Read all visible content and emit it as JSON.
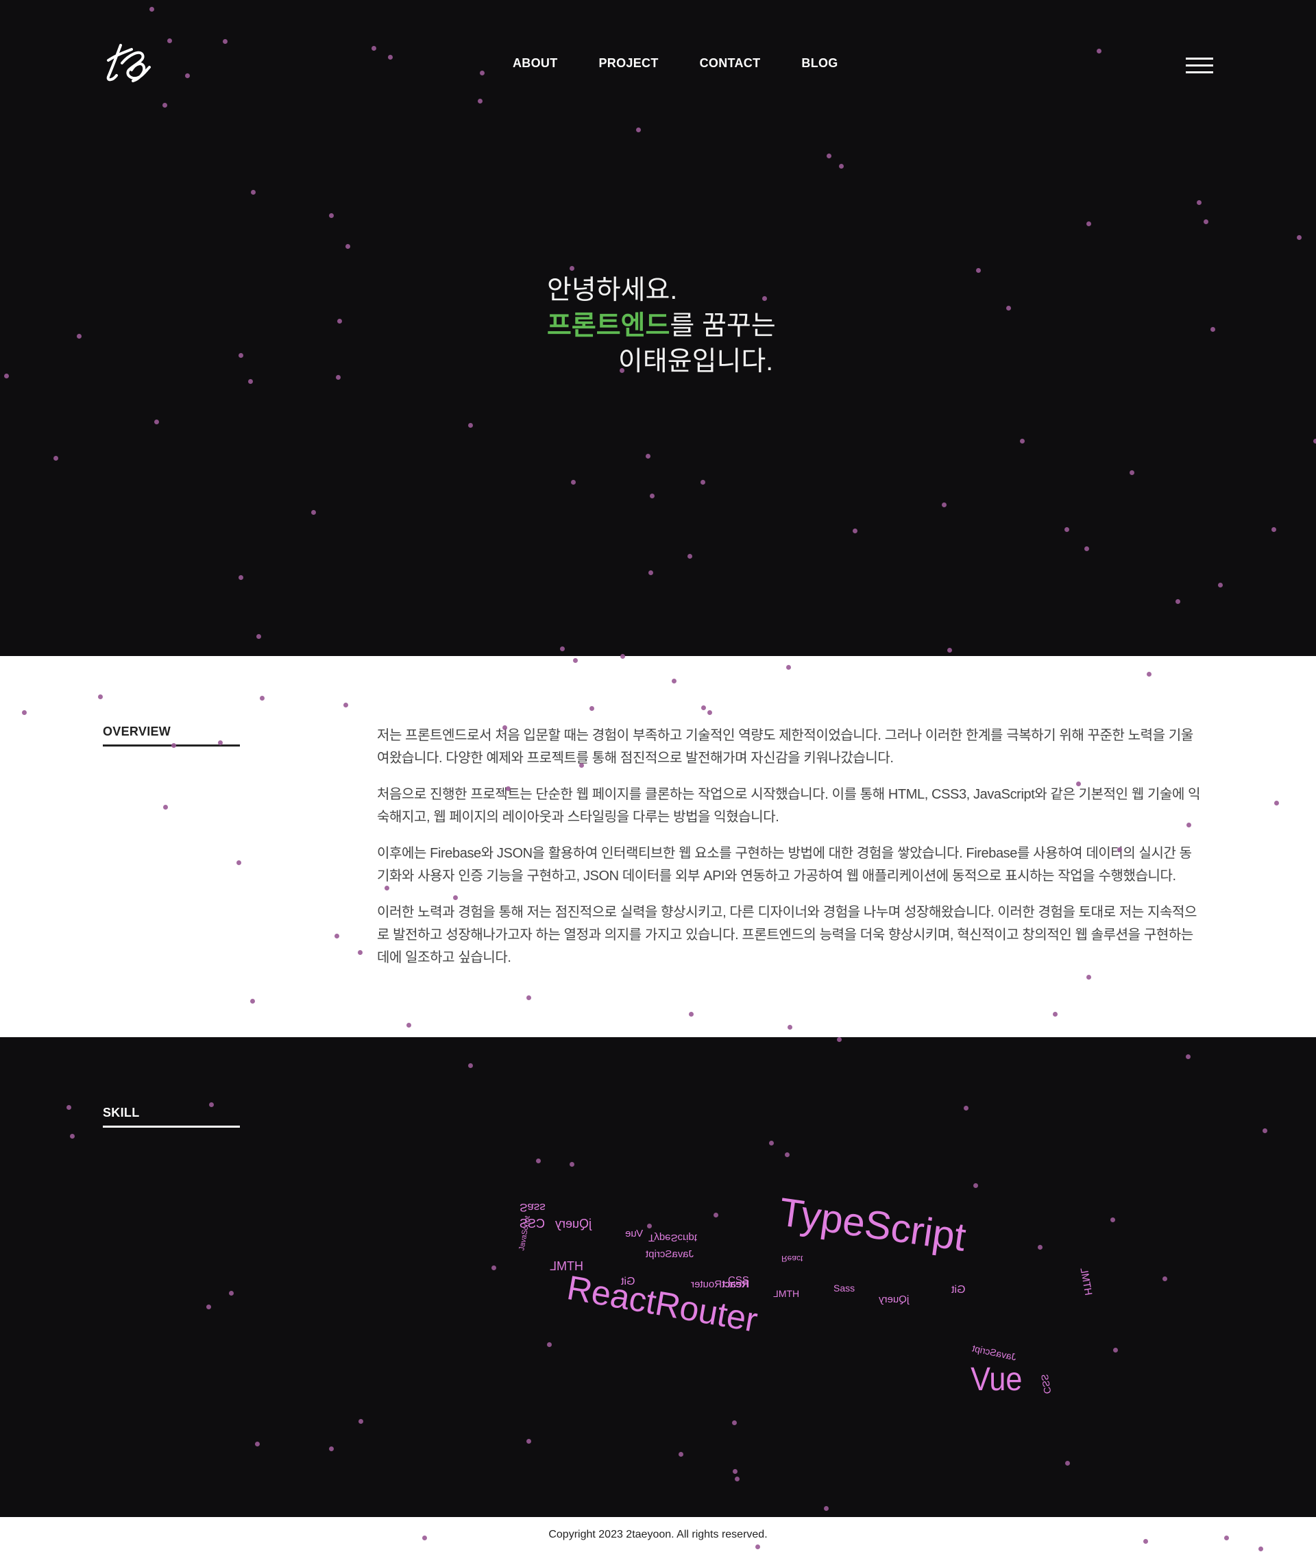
{
  "header": {
    "nav": [
      {
        "label": "ABOUT"
      },
      {
        "label": "PROJECT"
      },
      {
        "label": "CONTACT"
      },
      {
        "label": "BLOG"
      }
    ]
  },
  "hero": {
    "line1": "안녕하세요.",
    "line2_accent": "프론트엔드",
    "line2_rest": "를 꿈꾸는",
    "line3": "이태윤입니다."
  },
  "overview": {
    "title": "OVERVIEW",
    "paragraphs": [
      "저는 프론트엔드로서 처음 입문할 때는 경험이 부족하고 기술적인 역량도 제한적이었습니다. 그러나 이러한 한계를 극복하기 위해 꾸준한 노력을 기울여왔습니다. 다양한 예제와 프로젝트를 통해 점진적으로 발전해가며 자신감을 키워나갔습니다.",
      "처음으로 진행한 프로젝트는 단순한 웹 페이지를 클론하는 작업으로 시작했습니다. 이를 통해 HTML, CSS3, JavaScript와 같은 기본적인 웹 기술에 익숙해지고, 웹 페이지의 레이아웃과 스타일링을 다루는 방법을 익혔습니다.",
      "이후에는 Firebase와 JSON을 활용하여 인터랙티브한 웹 요소를 구현하는 방법에 대한 경험을 쌓았습니다. Firebase를 사용하여 데이터의 실시간 동기화와 사용자 인증 기능을 구현하고, JSON 데이터를 외부 API와 연동하고 가공하여 웹 애플리케이션에 동적으로 표시하는 작업을 수행했습니다.",
      "이러한 노력과 경험을 통해 저는 점진적으로 실력을 향상시키고, 다른 디자이너와 경험을 나누며 성장해왔습니다. 이러한 경험을 토대로 저는 지속적으로 발전하고 성장해나가고자 하는 열정과 의지를 가지고 있습니다. 프론트엔드의 능력을 더욱 향상시키며, 혁신적이고 창의적인 웹 솔루션을 구현하는 데에 일조하고 싶습니다."
    ]
  },
  "skill": {
    "title": "SKILL",
    "tags": [
      "Sass",
      "CSS",
      "jQuery",
      "Vue",
      "TypeScript",
      "JavaScript",
      "HTML",
      "Git",
      "ReactRouter",
      "React",
      "CSS",
      "Sass",
      "HTML",
      "jQuery",
      "Git",
      "TypeScript",
      "React",
      "JavaScript",
      "Vue",
      "CSS",
      "HTML",
      "ReactRouter",
      "JavaScript"
    ]
  },
  "footer": {
    "copyright": "Copyright 2023 2taeyoon. All rights reserved."
  },
  "colors": {
    "background": "#0e0d0f",
    "accent_green": "#5fba52",
    "tag_pink": "#e07fe0",
    "dot_purple": "#9a5a96"
  }
}
